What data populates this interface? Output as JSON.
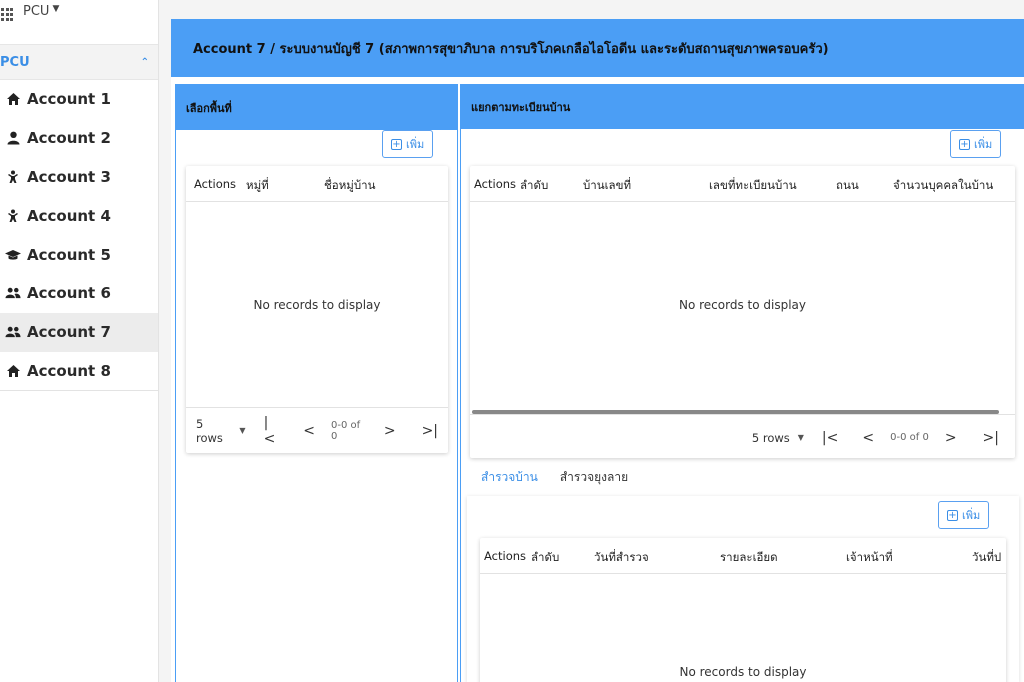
{
  "app": {
    "switcher_label": "PCU"
  },
  "sidebar": {
    "group_label": "PCU",
    "items": [
      {
        "label": "Account 1",
        "icon": "home-icon"
      },
      {
        "label": "Account 2",
        "icon": "user-icon"
      },
      {
        "label": "Account 3",
        "icon": "child-icon"
      },
      {
        "label": "Account 4",
        "icon": "child-icon"
      },
      {
        "label": "Account 5",
        "icon": "graduation-cap-icon"
      },
      {
        "label": "Account 6",
        "icon": "users-icon"
      },
      {
        "label": "Account 7",
        "icon": "users-icon",
        "active": true
      },
      {
        "label": "Account 8",
        "icon": "home-icon"
      }
    ]
  },
  "page": {
    "title": "Account 7 / ระบบงานบัญชี 7 (สภาพการสุขาภิบาล การบริโภคเกลือไอโอดีน และระดับสถานสุขภาพครอบครัว)"
  },
  "left_panel": {
    "header": "เลือกพื้นที่",
    "add_label": "เพิ่ม",
    "columns": [
      "Actions",
      "หมู่ที่",
      "ชื่อหมู่บ้าน"
    ],
    "empty_text": "No records to display",
    "rows_label": "5 rows",
    "page_count": "0-0 of 0"
  },
  "right_panel": {
    "header": "แยกตามทะเบียนบ้าน",
    "add_label": "เพิ่ม",
    "columns": [
      "Actions",
      "ลำดับ",
      "บ้านเลขที่",
      "เลขที่ทะเบียนบ้าน",
      "ถนน",
      "จำนวนบุคคลในบ้าน"
    ],
    "empty_text": "No records to display",
    "rows_label": "5 rows",
    "page_count": "0-0 of 0"
  },
  "survey": {
    "tabs": [
      "สำรวจบ้าน",
      "สำรวจยุงลาย"
    ],
    "active_tab": 0,
    "add_label": "เพิ่ม",
    "columns": [
      "Actions",
      "ลำดับ",
      "วันที่สำรวจ",
      "รายละเอียด",
      "เจ้าหน้าที่",
      "วันที่ป"
    ],
    "empty_text": "No records to display"
  },
  "colors": {
    "accent": "#4b9ef5",
    "link": "#3a8ee6"
  }
}
